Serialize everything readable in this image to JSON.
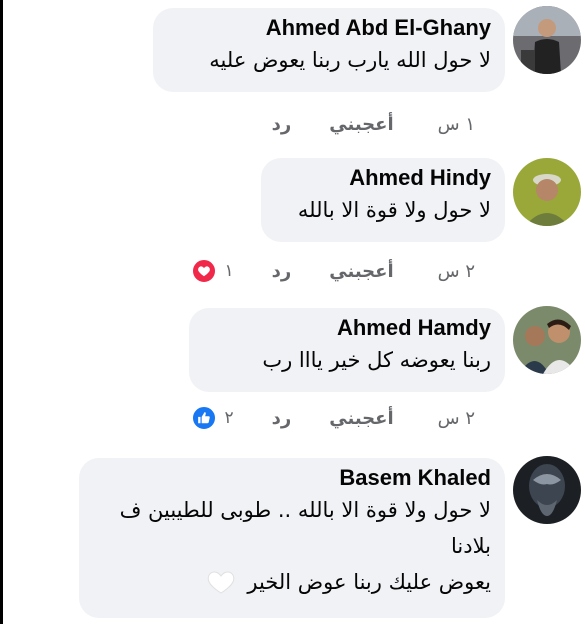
{
  "comments": [
    {
      "author": "Ahmed Abd El-Ghany",
      "text": "لا حول الله يارب ربنا يعوض عليه",
      "time": "١ س",
      "like_label": "أعجبني",
      "reply_label": "رد"
    },
    {
      "author": "Ahmed Hindy",
      "text": "لا حول ولا قوة الا بالله",
      "time": "٢ س",
      "like_label": "أعجبني",
      "reply_label": "رد",
      "reaction_count": "١",
      "reaction_icon": "heart-icon",
      "reaction_color": "#f02849"
    },
    {
      "author": "Ahmed Hamdy",
      "text": "ربنا يعوضه كل خير يااا رب",
      "time": "٢ س",
      "like_label": "أعجبني",
      "reply_label": "رد",
      "reaction_count": "٢",
      "reaction_icon": "thumbs-up-icon",
      "reaction_color": "#1877f2"
    },
    {
      "author": "Basem Khaled",
      "text_line1": "لا حول ولا قوة الا بالله .. طوبى للطيبين ف",
      "text_line2": "بلادنا",
      "text_line3": "يعوض عليك ربنا عوض الخير",
      "emoji": "white-heart-icon"
    }
  ]
}
